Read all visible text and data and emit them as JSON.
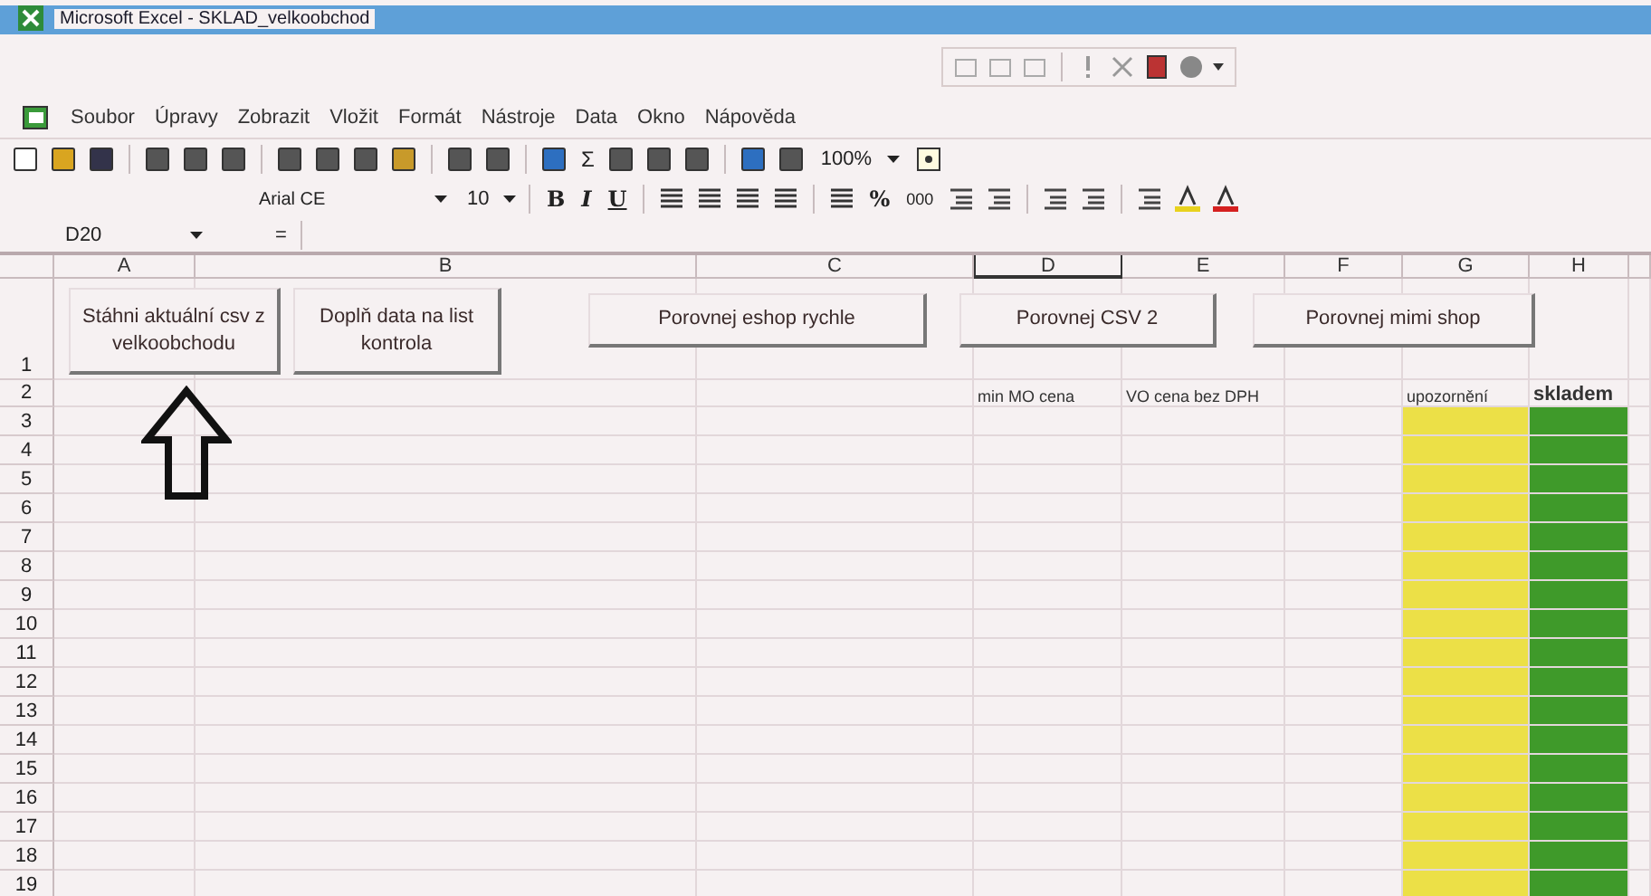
{
  "window": {
    "title": "Microsoft Excel - SKLAD_velkoobchod"
  },
  "menu": [
    "Soubor",
    "Úpravy",
    "Zobrazit",
    "Vložit",
    "Formát",
    "Nástroje",
    "Data",
    "Okno",
    "Nápověda"
  ],
  "standard_toolbar": {
    "sigma": "Σ",
    "zoom": "100%"
  },
  "formatting_toolbar": {
    "font": "Arial CE",
    "size": "10",
    "bold": "B",
    "italic": "I",
    "underline": "U",
    "percent": "%",
    "thousands": "000"
  },
  "name_box": "D20",
  "formula_label": "=",
  "columns": [
    {
      "label": "A",
      "selected": false
    },
    {
      "label": "B",
      "selected": false
    },
    {
      "label": "C",
      "selected": false
    },
    {
      "label": "D",
      "selected": true,
      "row2": "min MO cena"
    },
    {
      "label": "E",
      "selected": false,
      "row2": "VO cena bez DPH"
    },
    {
      "label": "F",
      "selected": false
    },
    {
      "label": "G",
      "selected": false,
      "row2": "upozornění",
      "color": "#ece047"
    },
    {
      "label": "H",
      "selected": false,
      "row2": "skladem",
      "row2_bold": true,
      "color": "#3f9a2a"
    }
  ],
  "rows": [
    "1",
    "2",
    "3",
    "4",
    "5",
    "6",
    "7",
    "8",
    "9",
    "10",
    "11",
    "12",
    "13",
    "14",
    "15",
    "16",
    "17",
    "18",
    "19"
  ],
  "buttons": [
    "Stáhni aktuální csv z velkoobchodu",
    "Doplň data na list kontrola",
    "Porovnej eshop rychle",
    "Porovnej CSV 2",
    "Porovnej mimi shop"
  ]
}
